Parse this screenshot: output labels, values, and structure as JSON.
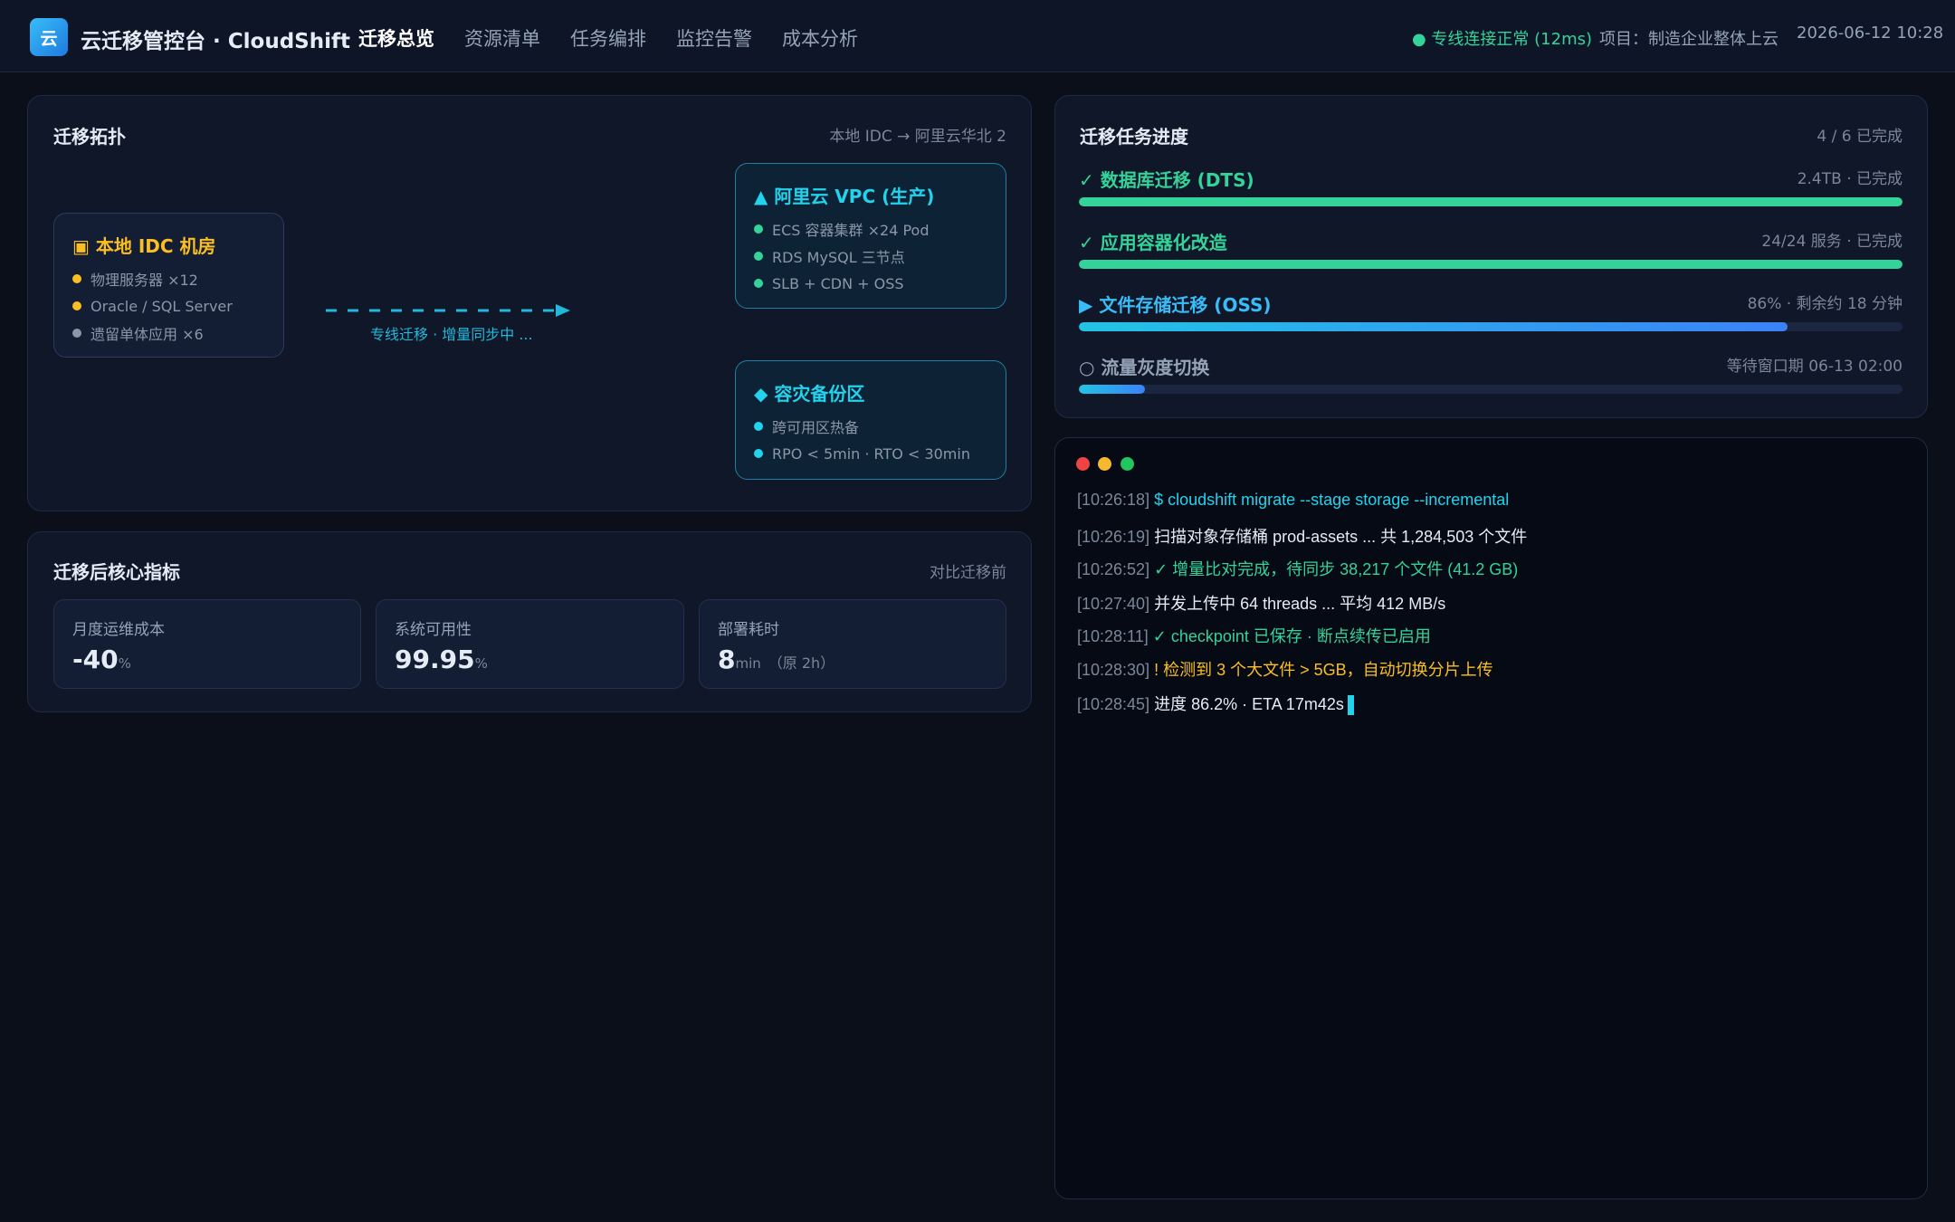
{
  "header": {
    "logo_text": "云",
    "title": "云迁移管控台 · CloudShift",
    "nav": [
      {
        "label": "迁移总览",
        "active": true
      },
      {
        "label": "资源清单",
        "active": false
      },
      {
        "label": "任务编排",
        "active": false
      },
      {
        "label": "监控告警",
        "active": false
      },
      {
        "label": "成本分析",
        "active": false
      }
    ],
    "connection_status": "● 专线连接正常 (12ms)",
    "project": "项目：制造企业整体上云",
    "datetime": "2026-06-12 10:28"
  },
  "topology": {
    "title": "迁移拓扑",
    "route": "本地 IDC → 阿里云华北 2",
    "source": {
      "title": "▣ 本地 IDC 机房",
      "color": "#fbbf24",
      "items": [
        {
          "label": "物理服务器 ×12",
          "dot": "#fbbf24"
        },
        {
          "label": "Oracle / SQL Server",
          "dot": "#fbbf24"
        },
        {
          "label": "遗留单体应用 ×6",
          "dot": "#8b97a8"
        }
      ]
    },
    "link_label": "专线迁移 · 增量同步中 ...",
    "targets": [
      {
        "title": "▲ 阿里云 VPC (生产)",
        "color": "#22d3ee",
        "items": [
          {
            "label": "ECS 容器集群 ×24 Pod",
            "dot": "#34d399"
          },
          {
            "label": "RDS MySQL 三节点",
            "dot": "#34d399"
          },
          {
            "label": "SLB + CDN + OSS",
            "dot": "#34d399"
          }
        ]
      },
      {
        "title": "◆ 容灾备份区",
        "color": "#22d3ee",
        "items": [
          {
            "label": "跨可用区热备",
            "dot": "#22d3ee"
          },
          {
            "label": "RPO < 5min · RTO < 30min",
            "dot": "#22d3ee"
          }
        ]
      }
    ]
  },
  "metrics": {
    "title": "迁移后核心指标",
    "meta": "对比迁移前",
    "cards": [
      {
        "label": "月度运维成本",
        "value": "-40",
        "unit": "%",
        "note": ""
      },
      {
        "label": "系统可用性",
        "value": "99.95",
        "unit": "%",
        "note": ""
      },
      {
        "label": "部署耗时",
        "value": "8",
        "unit": "min",
        "note": "（原 2h）"
      }
    ]
  },
  "progress": {
    "title": "迁移任务进度",
    "summary": "4 / 6 已完成",
    "tasks": [
      {
        "name": "✓ 数据库迁移 (DTS)",
        "status": "2.4TB · 已完成",
        "percent": 100,
        "name_color": "#34d399",
        "bar_color": "#34d399"
      },
      {
        "name": "✓ 应用容器化改造",
        "status": "24/24 服务 · 已完成",
        "percent": 100,
        "name_color": "#34d399",
        "bar_color": "#34d399"
      },
      {
        "name": "▶ 文件存储迁移 (OSS)",
        "status": "86% · 剩余约 18 分钟",
        "percent": 86,
        "name_color": "#38bdf8",
        "bar_color": "linear-gradient(90deg,#22c3e6,#3b82f6)"
      },
      {
        "name": "○ 流量灰度切换",
        "status": "等待窗口期 06-13 02:00",
        "percent": 8,
        "name_color": "#94a3b8",
        "bar_color": "linear-gradient(90deg,#22c3e6,#3b82f6)"
      }
    ]
  },
  "terminal": {
    "window_dots": [
      "#ef4444",
      "#f5b82e",
      "#22c55e"
    ],
    "lines": [
      {
        "ts": "[10:26:18]",
        "text": "$ cloudshift migrate --stage storage --incremental",
        "color": "#22d3ee"
      },
      {
        "ts": "[10:26:19]",
        "text": "扫描对象存储桶 prod-assets ... 共 1,284,503 个文件",
        "color": "#e5ecf5"
      },
      {
        "ts": "[10:26:52]",
        "text": "✓ 增量比对完成，待同步 38,217 个文件 (41.2 GB)",
        "color": "#34d399"
      },
      {
        "ts": "[10:27:40]",
        "text": "并发上传中 64 threads ... 平均 412 MB/s",
        "color": "#e5ecf5"
      },
      {
        "ts": "[10:28:11]",
        "text": "✓ checkpoint 已保存 · 断点续传已启用",
        "color": "#34d399"
      },
      {
        "ts": "[10:28:30]",
        "text": "! 检测到 3 个大文件 > 5GB，自动切换分片上传",
        "color": "#fbbf24"
      },
      {
        "ts": "[10:28:45]",
        "text": "进度 86.2% · ETA 17m42s",
        "color": "#e5ecf5"
      }
    ]
  }
}
